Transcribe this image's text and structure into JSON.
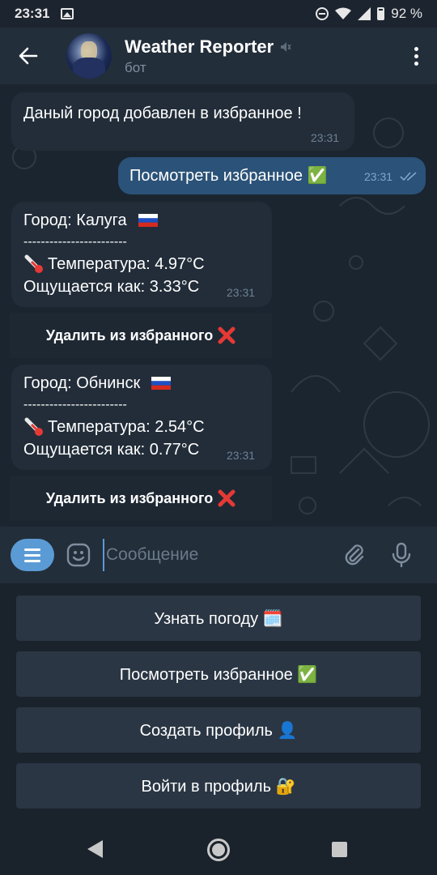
{
  "status_bar": {
    "time": "23:31",
    "battery": "92 %"
  },
  "header": {
    "title": "Weather Reporter",
    "subtitle": "бот"
  },
  "messages": [
    {
      "text": "Даный город добавлен в избранное !",
      "time": "23:31"
    },
    {
      "text": "Посмотреть избранное ✅",
      "time": "23:31"
    }
  ],
  "cards": [
    {
      "city_line": "Город:   Калуга",
      "divider": "------------------------",
      "temp_line": "Температура: 4.97°C",
      "feels_line": "Ощущается как: 3.33°C",
      "time": "23:31",
      "button": "Удалить из избранного"
    },
    {
      "city_line": "Город:   Обнинск",
      "divider": "------------------------",
      "temp_line": "Температура: 2.54°C",
      "feels_line": "Ощущается как: 0.77°C",
      "time": "23:31",
      "button": "Удалить из избранного"
    }
  ],
  "input": {
    "placeholder": "Сообщение"
  },
  "keyboard": [
    "Узнать погоду 🗓️",
    "Посмотреть избранное ✅",
    "Создать профиль 👤",
    "Войти в профиль 🔐"
  ],
  "colors": {
    "chat_bg": "#1b2530",
    "header_bg": "#222e3a",
    "incoming_bubble": "#222d39",
    "outgoing_bubble": "#2b5278",
    "accent": "#5b9bd5",
    "delete_cross": "#e53935"
  }
}
